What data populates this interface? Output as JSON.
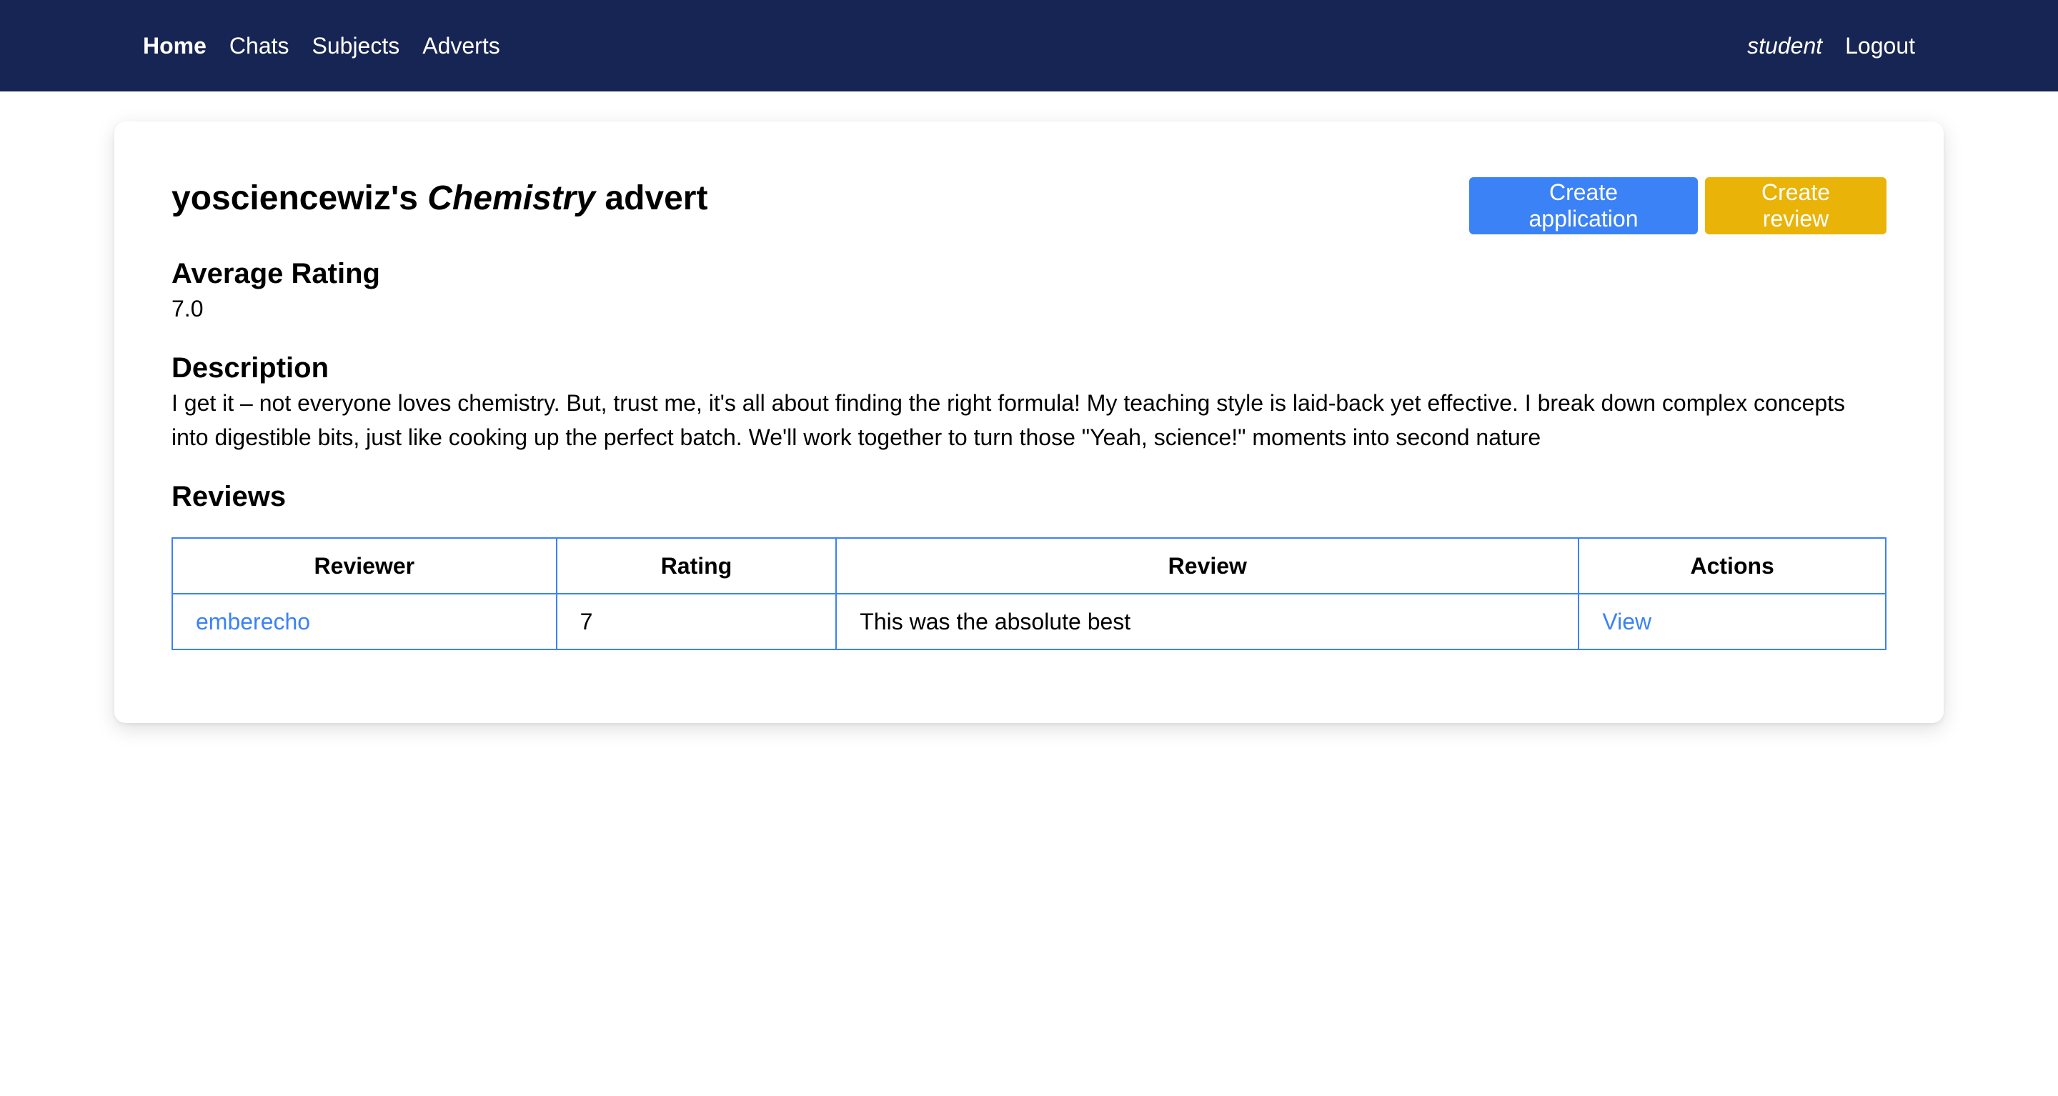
{
  "nav": {
    "home": "Home",
    "chats": "Chats",
    "subjects": "Subjects",
    "adverts": "Adverts",
    "user": "student",
    "logout": "Logout"
  },
  "advert": {
    "title_owner": "yosciencewiz's",
    "title_subject": "Chemistry",
    "title_suffix": "advert",
    "create_application_label": "Create application",
    "create_review_label": "Create review",
    "average_rating_heading": "Average Rating",
    "average_rating_value": "7.0",
    "description_heading": "Description",
    "description_text": "I get it – not everyone loves chemistry. But, trust me, it's all about finding the right formula! My teaching style is laid-back yet effective. I break down complex concepts into digestible bits, just like cooking up the perfect batch. We'll work together to turn those \"Yeah, science!\" moments into second nature",
    "reviews_heading": "Reviews"
  },
  "reviews_table": {
    "columns": [
      "Reviewer",
      "Rating",
      "Review",
      "Actions"
    ],
    "rows": [
      {
        "reviewer": "emberecho",
        "rating": "7",
        "review": "This was the absolute best",
        "action": "View"
      }
    ]
  },
  "colors": {
    "navbar": "#172554",
    "primary": "#3b82f6",
    "warning": "#eab308"
  }
}
